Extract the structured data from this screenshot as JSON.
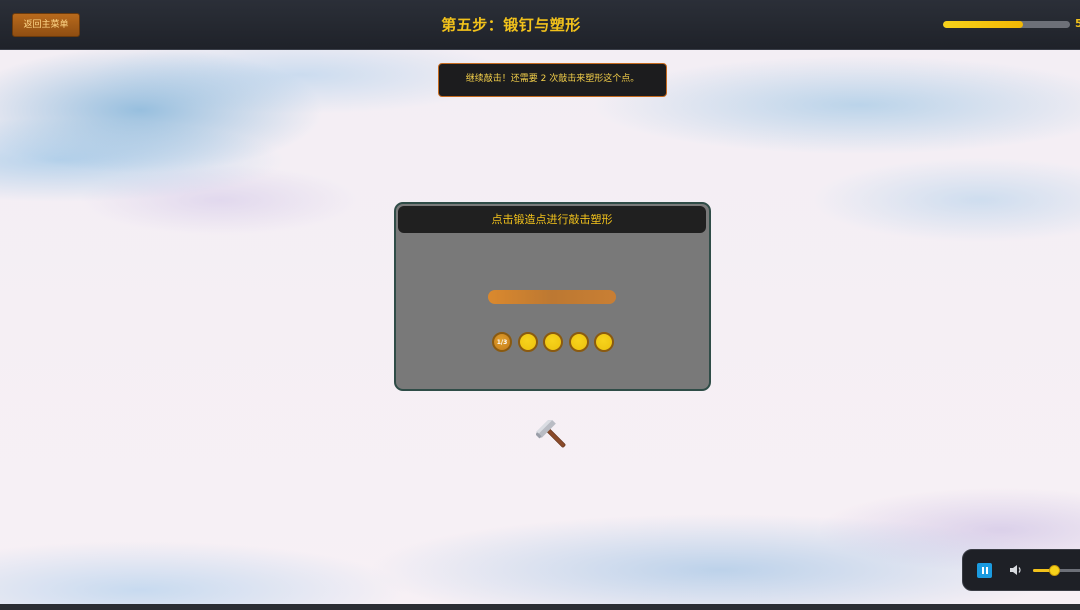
{
  "header": {
    "back_label": "返回主菜单",
    "title": "第五步：锻钉与塑形",
    "progress_value": 0.63,
    "progress_text": "5"
  },
  "hint": {
    "text": "继续敲击！还需要 2 次敲击来塑形这个点。"
  },
  "forge_panel": {
    "title": "点击锻造点进行敲击塑形",
    "points": [
      {
        "label": "1/3",
        "state": "active"
      },
      {
        "label": "",
        "state": "idle"
      },
      {
        "label": "",
        "state": "idle"
      },
      {
        "label": "",
        "state": "idle"
      },
      {
        "label": "",
        "state": "idle"
      }
    ]
  },
  "music": {
    "pause_icon": "pause-icon",
    "volume_icon": "volume-icon",
    "volume_level": 0.35
  },
  "colors": {
    "accent_gold": "#f2c21b",
    "button_orange": "#a35c18",
    "panel_gray": "#797979",
    "nail_orange": "#d07c2c",
    "pause_blue": "#1b9be0"
  }
}
